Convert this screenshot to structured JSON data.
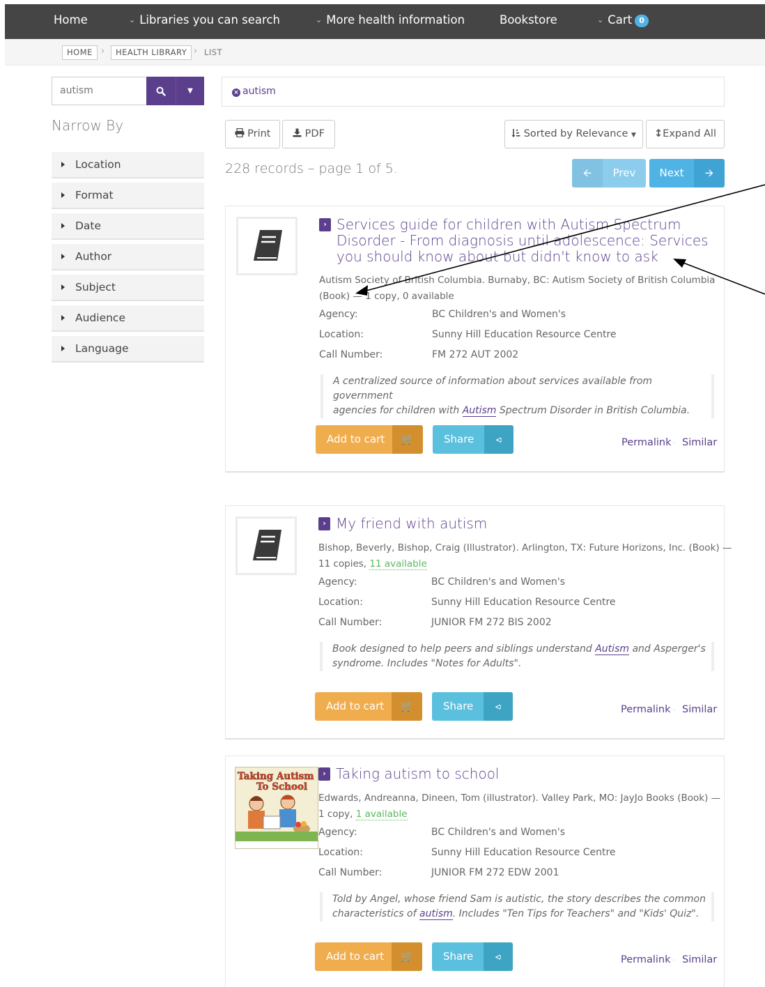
{
  "nav": {
    "home": "Home",
    "libraries": "Libraries you can search",
    "more_health": "More health information",
    "bookstore": "Bookstore",
    "cart": "Cart",
    "cart_count": "0"
  },
  "breadcrumb": {
    "home": "HOME",
    "health_library": "HEALTH LIBRARY",
    "list": "LIST"
  },
  "sidebar": {
    "search_value": "autism",
    "narrow_by": "Narrow By",
    "facets": [
      "Location",
      "Format",
      "Date",
      "Author",
      "Subject",
      "Audience",
      "Language"
    ]
  },
  "search_term": "autism",
  "toolbar": {
    "print": "Print",
    "pdf": "PDF",
    "sort": "Sorted by Relevance",
    "expand": "Expand All",
    "records": "228 records – page 1 of 5.",
    "prev": "Prev",
    "next": "Next"
  },
  "labels": {
    "agency": "Agency:",
    "location": "Location:",
    "call_number": "Call Number:",
    "add_to_cart": "Add to cart",
    "share": "Share",
    "permalink": "Permalink",
    "similar": "Similar"
  },
  "results": [
    {
      "title_lines": [
        "Services guide for children with Autism Spectrum",
        "Disorder - From diagnosis until adolescence: Services",
        "you should know about but didn't know to ask"
      ],
      "meta_line1": "Autism Society of British Columbia. Burnaby, BC: Autism Society of British Columbia",
      "meta_line2": "(Book) — 1 copy, 0 available",
      "available": "",
      "agency": "BC Children's and Women's",
      "location": "Sunny Hill Education Resource Centre",
      "call_number": "FM 272 AUT 2002",
      "summary_a": "A centralized source of information about services available from government",
      "summary_b1": "agencies for children with ",
      "summary_term": "Autism",
      "summary_b2": " Spectrum Disorder in British Columbia."
    },
    {
      "title_lines": [
        "My friend with autism"
      ],
      "meta_line1": "Bishop, Beverly, Bishop, Craig (Illustrator). Arlington, TX: Future Horizons, Inc. (Book) —",
      "meta_line2": "11 copies, ",
      "available": "11 available",
      "agency": "BC Children's and Women's",
      "location": "Sunny Hill Education Resource Centre",
      "call_number": "JUNIOR FM 272 BIS 2002",
      "summary_a1": "Book designed to help peers and siblings understand ",
      "summary_term": "Autism",
      "summary_a2": " and Asperger's",
      "summary_b": "syndrome. Includes \"Notes for Adults\"."
    },
    {
      "title_lines": [
        "Taking autism to school"
      ],
      "meta_line1": "Edwards, Andreanna, Dineen, Tom (illustrator). Valley Park, MO: JayJo Books (Book) —",
      "meta_line2": "1 copy, ",
      "available": "1 available",
      "agency": "BC Children's and Women's",
      "location": "Sunny Hill Education Resource Centre",
      "call_number": "JUNIOR FM 272 EDW 2001",
      "summary_a": "Told by Angel, whose friend Sam is autistic, the story describes the common",
      "summary_b1": "characteristics of ",
      "summary_term": "autism",
      "summary_b2": ". Includes \"Ten Tips for Teachers\" and \"Kids' Quiz\".",
      "cover_title_1": "Taking Autism",
      "cover_title_2": "To School"
    }
  ],
  "colors": {
    "nav_bg": "#454545",
    "brand_purple": "#5b3f8c",
    "cart_orange": "#f0ad4e",
    "share_blue": "#5bc0de",
    "pager_blue": "#4fb3e5"
  }
}
